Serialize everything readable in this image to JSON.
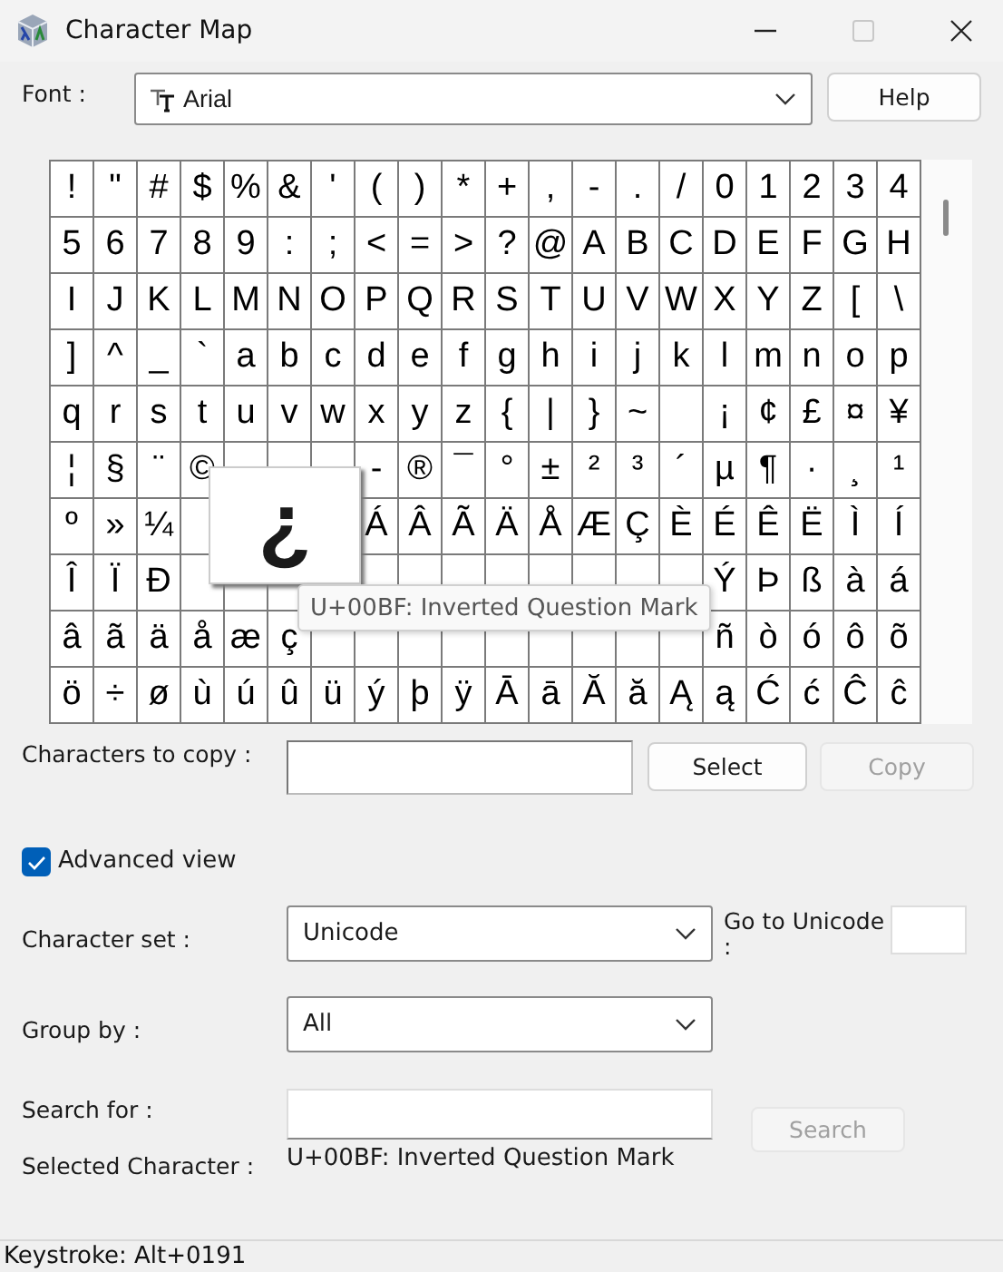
{
  "window": {
    "title": "Character Map",
    "controls": [
      {
        "kind": "minimize",
        "disabled": false
      },
      {
        "kind": "maximize",
        "disabled": true
      },
      {
        "kind": "close",
        "disabled": false
      }
    ]
  },
  "font": {
    "label": "Font :",
    "value": "Arial"
  },
  "help_button": {
    "label": "Help",
    "disabled": false
  },
  "grid": {
    "rows": [
      [
        "!",
        "\"",
        "#",
        "$",
        "%",
        "&",
        "'",
        "(",
        ")",
        "*",
        "+",
        ",",
        "-",
        ".",
        "/",
        "0",
        "1",
        "2",
        "3",
        "4"
      ],
      [
        "5",
        "6",
        "7",
        "8",
        "9",
        ":",
        ";",
        "<",
        "=",
        ">",
        "?",
        "@",
        "A",
        "B",
        "C",
        "D",
        "E",
        "F",
        "G",
        "H"
      ],
      [
        "I",
        "J",
        "K",
        "L",
        "M",
        "N",
        "O",
        "P",
        "Q",
        "R",
        "S",
        "T",
        "U",
        "V",
        "W",
        "X",
        "Y",
        "Z",
        "[",
        "\\"
      ],
      [
        "]",
        "^",
        "_",
        "`",
        "a",
        "b",
        "c",
        "d",
        "e",
        "f",
        "g",
        "h",
        "i",
        "j",
        "k",
        "l",
        "m",
        "n",
        "o",
        "p"
      ],
      [
        "q",
        "r",
        "s",
        "t",
        "u",
        "v",
        "w",
        "x",
        "y",
        "z",
        "{",
        "|",
        "}",
        "~",
        null,
        "¡",
        "¢",
        "£",
        "¤",
        "¥"
      ],
      [
        "¦",
        "§",
        "¨",
        "©",
        null,
        null,
        null,
        "-",
        "®",
        "¯",
        "°",
        "±",
        "²",
        "³",
        "´",
        "µ",
        "¶",
        "·",
        "¸",
        "¹"
      ],
      [
        "º",
        "»",
        "¼",
        null,
        null,
        null,
        null,
        "Á",
        "Â",
        "Ã",
        "Ä",
        "Å",
        "Æ",
        "Ç",
        "È",
        "É",
        "Ê",
        "Ë",
        "Ì",
        "Í"
      ],
      [
        "Î",
        "Ï",
        "Ð",
        null,
        null,
        null,
        null,
        null,
        null,
        null,
        null,
        null,
        null,
        null,
        null,
        "Ý",
        "Þ",
        "ß",
        "à",
        "á"
      ],
      [
        "â",
        "ã",
        "ä",
        "å",
        "æ",
        "ç",
        null,
        null,
        null,
        null,
        null,
        null,
        null,
        null,
        null,
        "ñ",
        "ò",
        "ó",
        "ô",
        "õ"
      ],
      [
        "ö",
        "÷",
        "ø",
        "ù",
        "ú",
        "û",
        "ü",
        "ý",
        "þ",
        "ÿ",
        "Ā",
        "ā",
        "Ă",
        "ă",
        "Ą",
        "ą",
        "Ć",
        "ć",
        "Ĉ",
        "ĉ"
      ]
    ]
  },
  "magnifier": {
    "char": "¿"
  },
  "tooltip": "U+00BF: Inverted Question Mark",
  "copy_row": {
    "label": "Characters to copy :",
    "buttons": [
      {
        "label": "Select",
        "disabled": false
      },
      {
        "label": "Copy",
        "disabled": true
      }
    ]
  },
  "advanced_view": {
    "label": "Advanced view",
    "checked": true
  },
  "character_set": {
    "label": "Character set :",
    "value": "Unicode"
  },
  "go_to_unicode": {
    "label": "Go to Unicode :"
  },
  "group_by": {
    "label": "Group by :",
    "value": "All"
  },
  "search": {
    "label": "Search for :",
    "button": {
      "label": "Search",
      "disabled": true
    }
  },
  "selected_character": {
    "label": "Selected Character :",
    "value": "U+00BF: Inverted Question Mark"
  },
  "status_bar": "Keystroke: Alt+0191"
}
